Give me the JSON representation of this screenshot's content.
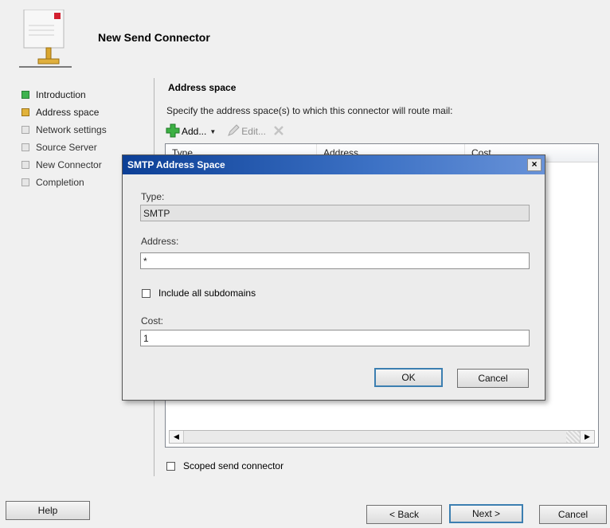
{
  "wizard": {
    "title": "New Send Connector",
    "steps": [
      {
        "label": "Introduction",
        "state": "done"
      },
      {
        "label": "Address space",
        "state": "current"
      },
      {
        "label": "Network settings",
        "state": "pending"
      },
      {
        "label": "Source Server",
        "state": "pending"
      },
      {
        "label": "New Connector",
        "state": "pending"
      },
      {
        "label": "Completion",
        "state": "pending"
      }
    ],
    "section_title": "Address space",
    "section_desc": "Specify the address space(s) to which this connector will route mail:",
    "toolbar": {
      "add_label": "Add...",
      "edit_label": "Edit...",
      "add_icon": "green-plus-icon",
      "edit_icon": "pencil-icon",
      "remove_icon": "red-x-icon"
    },
    "columns": [
      "Type",
      "Address",
      "Cost"
    ],
    "scoped_label": "Scoped send connector",
    "buttons": {
      "help": "Help",
      "back": "< Back",
      "next": "Next >",
      "cancel": "Cancel"
    }
  },
  "dialog": {
    "title": "SMTP Address Space",
    "close_glyph": "×",
    "type_label": "Type:",
    "type_value": "SMTP",
    "address_label": "Address:",
    "address_value": "*",
    "subdomains_label": "Include all subdomains",
    "cost_label": "Cost:",
    "cost_value": "1",
    "ok_label": "OK",
    "cancel_label": "Cancel"
  },
  "colors": {
    "title_bar_start": "#0c3f96",
    "title_bar_end": "#6892d8",
    "step_done": "#3fb34f",
    "step_current": "#e1b23b"
  }
}
